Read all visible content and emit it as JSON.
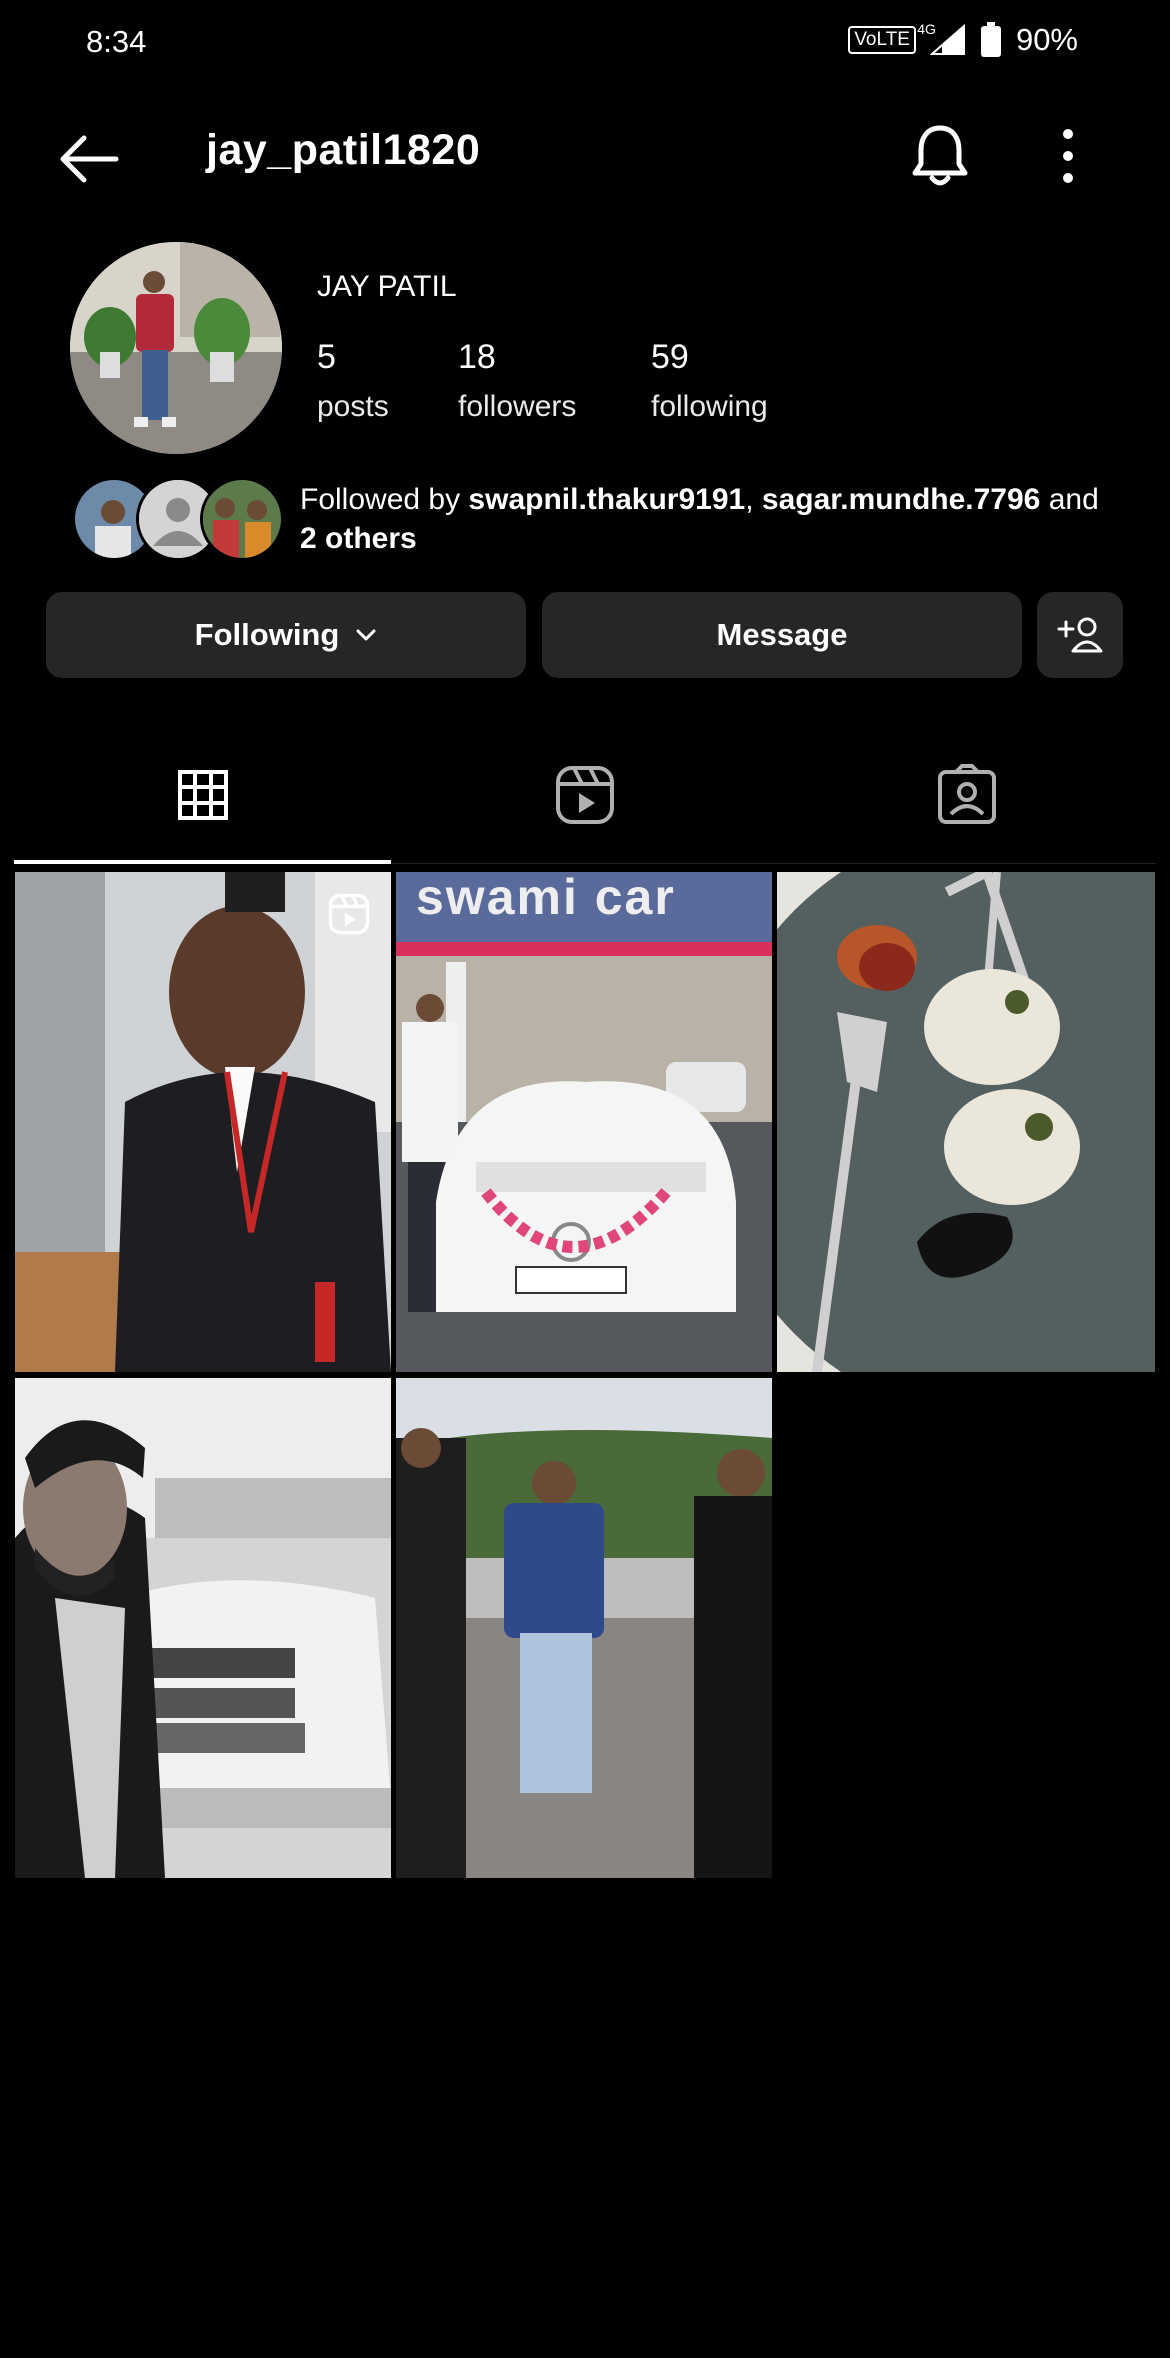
{
  "status_bar": {
    "time": "8:34",
    "volte": "VoLTE",
    "network": "4G",
    "battery": "90%"
  },
  "header": {
    "username": "jay_patil1820"
  },
  "profile": {
    "full_name": "JAY PATIL",
    "stats": [
      {
        "value": "5",
        "label": "posts"
      },
      {
        "value": "18",
        "label": "followers"
      },
      {
        "value": "59",
        "label": "following"
      }
    ],
    "followed_by": {
      "prefix": "Followed by ",
      "user1": "swapnil.thakur9191",
      "sep": ", ",
      "user2": "sagar.mundhe.7796",
      "conj": " and",
      "others": "2 others"
    }
  },
  "actions": {
    "following_label": "Following",
    "message_label": "Message"
  },
  "tabs": [
    "posts-grid",
    "reels",
    "tagged"
  ],
  "posts": [
    {
      "type": "reel",
      "desc": ""
    },
    {
      "type": "photo",
      "sign_text": "swami car"
    },
    {
      "type": "photo"
    },
    {
      "type": "photo"
    },
    {
      "type": "photo"
    }
  ],
  "colors": {
    "background": "#000000",
    "button_bg": "#262626",
    "text": "#ffffff"
  }
}
